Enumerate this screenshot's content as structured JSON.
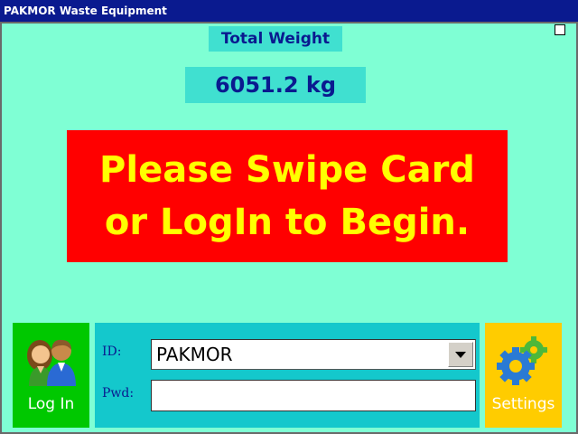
{
  "window": {
    "title": "PAKMOR Waste Equipment"
  },
  "weight": {
    "label": "Total Weight",
    "value": "6051.2 kg"
  },
  "banner": {
    "line1": "Please Swipe Card",
    "line2": "or LogIn to Begin."
  },
  "login": {
    "button_label": "Log In",
    "icon": "users-icon",
    "id_label": "ID:",
    "id_value": "PAKMOR",
    "pwd_label": "Pwd:",
    "pwd_value": ""
  },
  "settings": {
    "button_label": "Settings",
    "icon": "gears-icon"
  },
  "colors": {
    "background": "#7fffd4",
    "banner_bg": "#ff0000",
    "banner_text": "#ffff00",
    "login_bg": "#00c800",
    "settings_bg": "#ffcc00",
    "panel_bg": "#14c8cc",
    "accent": "#0a1a8f"
  }
}
